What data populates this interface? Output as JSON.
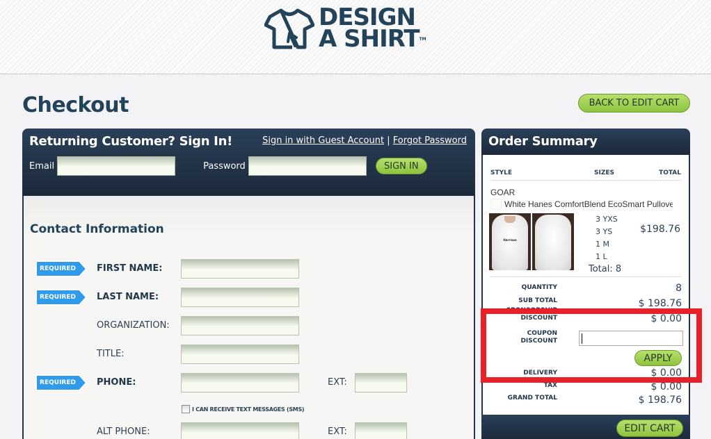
{
  "header": {
    "logo_line1": "DESIGN",
    "logo_line2": "A SHIRT",
    "logo_tm": "TM"
  },
  "page": {
    "title": "Checkout",
    "back_button": "BACK TO EDIT CART"
  },
  "signin": {
    "title": "Returning Customer? Sign In!",
    "guest_link": "Sign in with Guest Account",
    "separator": "|",
    "forgot_link": "Forgot Password",
    "email_label": "Email",
    "email_value": "",
    "password_label": "Password",
    "password_value": "",
    "button": "SIGN IN"
  },
  "contact": {
    "title": "Contact Information",
    "required_badge": "REQUIRED",
    "fields": [
      {
        "label": "FIRST NAME:",
        "required": true,
        "value": ""
      },
      {
        "label": "LAST NAME:",
        "required": true,
        "value": ""
      },
      {
        "label": "ORGANIZATION:",
        "required": false,
        "value": ""
      },
      {
        "label": "TITLE:",
        "required": false,
        "value": ""
      },
      {
        "label": "PHONE:",
        "required": true,
        "value": "",
        "ext_label": "EXT:",
        "ext_value": ""
      },
      {
        "label": "ALT PHONE:",
        "required": false,
        "value": "",
        "ext_label": "EXT:",
        "ext_value": ""
      }
    ],
    "sms_label": "I CAN RECEIVE TEXT MESSAGES (SMS)",
    "sms_checked": false
  },
  "order_summary": {
    "title": "Order Summary",
    "columns": {
      "style": "STYLE",
      "sizes": "SIZES",
      "total": "TOTAL"
    },
    "item": {
      "name": "GOAR",
      "description": "White Hanes ComfortBlend EcoSmart Pullover Hood",
      "print_text": "Harrison",
      "sizes": [
        "3 YXS",
        "3 YS",
        "1 M",
        "1 L"
      ],
      "total_count": "Total: 8",
      "price": "$198.76"
    },
    "summary": {
      "quantity_label": "QUANTITY",
      "quantity": "8",
      "subtotal_label": "SUB TOTAL",
      "subtotal": "$ 198.76",
      "sponsorship_label_1": "SPONSORSHIP",
      "sponsorship_label_2": "DISCOUNT",
      "sponsorship": "$ 0.00",
      "coupon_label_1": "COUPON",
      "coupon_label_2": "DISCOUNT",
      "coupon_value": "",
      "apply_button": "APPLY",
      "delivery_label": "DELIVERY",
      "delivery": "$ 0.00",
      "tax_label": "TAX",
      "tax": "$ 0.00",
      "grand_total_label": "GRAND TOTAL",
      "grand_total": "$ 198.76"
    },
    "edit_cart_button": "EDIT CART"
  },
  "colors": {
    "navy": "#22435a",
    "panel_dark": "#1d2a3b",
    "green_button": "#8ec33f",
    "required_blue": "#2f9bea",
    "highlight_red": "#e8202a"
  }
}
